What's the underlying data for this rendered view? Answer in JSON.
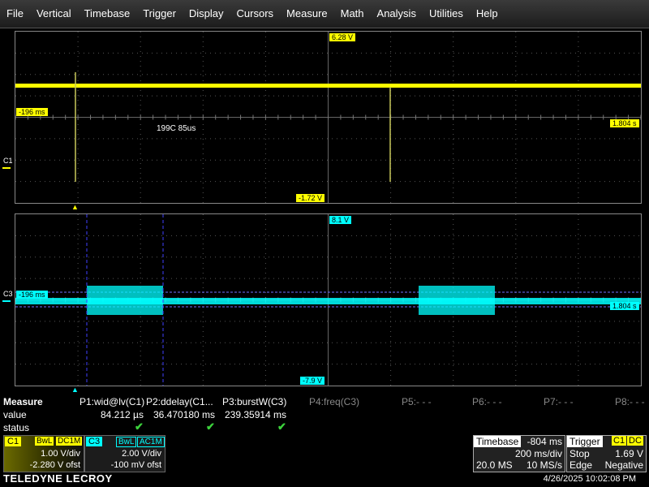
{
  "menu": [
    "File",
    "Vertical",
    "Timebase",
    "Trigger",
    "Display",
    "Cursors",
    "Measure",
    "Math",
    "Analysis",
    "Utilities",
    "Help"
  ],
  "grid1": {
    "top_level": "6.28 V",
    "bottom_level": "-1.72 V",
    "left_time": "-196 ms",
    "right_time": "1.804 s",
    "annotation": "199C 85us",
    "channel_label": "C1",
    "trace_color": "#ffff00"
  },
  "grid2": {
    "top_level": "8.1 V",
    "bottom_level": "-7.9 V",
    "left_time": "-196 ms",
    "right_time": "1.804 s",
    "channel_label": "C3",
    "trace_color": "#00ffff"
  },
  "measure": {
    "title": "Measure",
    "row_labels": [
      "value",
      "status"
    ],
    "params": [
      {
        "name": "P1:wid@lv(C1)",
        "value": "84.212 µs",
        "status": "✔"
      },
      {
        "name": "P2:ddelay(C1...",
        "value": "36.470180 ms",
        "status": "✔"
      },
      {
        "name": "P3:burstW(C3)",
        "value": "239.35914 ms",
        "status": "✔"
      },
      {
        "name": "P4:freq(C3)",
        "value": "",
        "status": ""
      },
      {
        "name": "P5:- - -",
        "value": "",
        "status": ""
      },
      {
        "name": "P6:- - -",
        "value": "",
        "status": ""
      },
      {
        "name": "P7:- - -",
        "value": "",
        "status": ""
      },
      {
        "name": "P8:- - -",
        "value": "",
        "status": ""
      }
    ]
  },
  "c1": {
    "label": "C1",
    "bw": "BwL",
    "coupling": "DC1M",
    "vdiv": "1.00 V/div",
    "offset": "-2.280 V ofst"
  },
  "c3": {
    "label": "C3",
    "bw": "BwL",
    "coupling": "AC1M",
    "vdiv": "2.00 V/div",
    "offset": "-100 mV ofst"
  },
  "timebase": {
    "label": "Timebase",
    "delay": "-804 ms",
    "tdiv": "200 ms/div",
    "samples": "20.0 MS",
    "rate": "10 MS/s"
  },
  "trigger": {
    "label": "Trigger",
    "source": "C1",
    "coupling": "DC",
    "mode": "Stop",
    "level": "1.69 V",
    "type": "Edge",
    "slope": "Negative"
  },
  "brand": "TELEDYNE LECROY",
  "datetime": "4/26/2025 10:02:08 PM"
}
